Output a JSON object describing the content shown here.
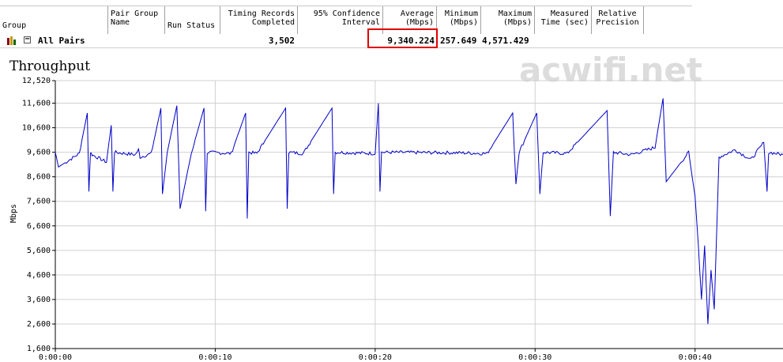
{
  "grid": {
    "headers": {
      "group": "Group",
      "pair_group_name": "Pair Group\nName",
      "run_status": "Run Status",
      "timing_records": "Timing Records\nCompleted",
      "confidence": "95% Confidence\nInterval",
      "average": "Average\n(Mbps)",
      "minimum": "Minimum\n(Mbps)",
      "maximum": "Maximum\n(Mbps)",
      "measured_time": "Measured\nTime (sec)",
      "relative_precision": "Relative\nPrecision"
    },
    "row": {
      "group": "All Pairs",
      "collapse": "−",
      "timing_records": "3,502",
      "average": "9,340.224",
      "minimum": "257.649",
      "maximum": "4,571.429"
    }
  },
  "watermark": "acwifi.net",
  "colors": {
    "line": "#0000c8",
    "grid": "#d0d0d0",
    "highlight": "#e00000"
  },
  "chart_data": {
    "type": "line",
    "title": "Throughput",
    "ylabel": "Mbps",
    "xlabel": "",
    "ylim": [
      1600,
      12520
    ],
    "yticks": [
      1600,
      2600,
      3600,
      4600,
      5600,
      6600,
      7600,
      8600,
      9600,
      10600,
      11600,
      12520
    ],
    "ytick_labels": [
      "1,600",
      "2,600",
      "3,600",
      "4,600",
      "5,600",
      "6,600",
      "7,600",
      "8,600",
      "9,600",
      "10,600",
      "11,600",
      "12,520"
    ],
    "xlim": [
      0,
      45.5
    ],
    "xticks": [
      0,
      10,
      20,
      30,
      40
    ],
    "xtick_labels": [
      "0:00:00",
      "0:00:10",
      "0:00:20",
      "0:00:30",
      "0:00:40"
    ],
    "grid": true,
    "baseline": 9580,
    "series": [
      {
        "values_sec": [
          0,
          0.2,
          1.5,
          2.0,
          2.1,
          2.2,
          2.3,
          3.2,
          3.5,
          3.6,
          3.7,
          5.0,
          5.2,
          5.3,
          6.0,
          6.6,
          6.7,
          7.0,
          7.6,
          7.8,
          8.5,
          9.3,
          9.4,
          9.5,
          11.0,
          11.9,
          12.0,
          12.1,
          12.6,
          14.4,
          14.5,
          14.6,
          15.5,
          17.3,
          17.4,
          17.5,
          20.0,
          20.2,
          20.3,
          20.4,
          25.0,
          27.0,
          28.6,
          28.8,
          29.0,
          30.1,
          30.3,
          30.5,
          32.0,
          34.5,
          34.7,
          34.9,
          36.0,
          37.5,
          38.0,
          38.2,
          39.6,
          40.0,
          40.2,
          40.4,
          40.6,
          40.8,
          41.0,
          41.2,
          41.5,
          42.5,
          43.5,
          44.3,
          44.5,
          44.6,
          45.5
        ],
        "values_mbps": [
          9600,
          9000,
          9550,
          11200,
          8000,
          9600,
          9500,
          9200,
          10700,
          8000,
          9600,
          9500,
          9700,
          9400,
          9550,
          11400,
          7900,
          9600,
          11500,
          7300,
          9550,
          11400,
          7200,
          9600,
          9550,
          11200,
          6900,
          9600,
          9550,
          11400,
          7300,
          9600,
          9550,
          11400,
          7900,
          9600,
          9550,
          11600,
          8000,
          9600,
          9580,
          9550,
          11200,
          8300,
          9600,
          11200,
          7900,
          9600,
          9550,
          11300,
          7000,
          9600,
          9500,
          9800,
          11800,
          8400,
          9600,
          7800,
          5900,
          3600,
          5800,
          2600,
          4800,
          3200,
          9400,
          9700,
          9300,
          10000,
          8000,
          9600,
          9500
        ]
      }
    ]
  }
}
